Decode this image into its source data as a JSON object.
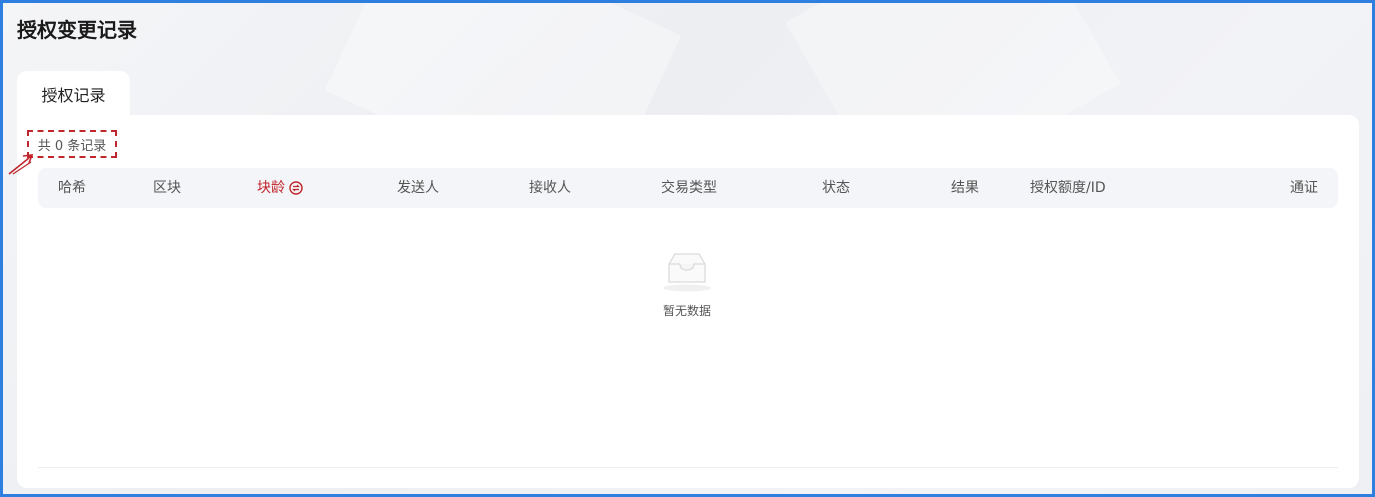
{
  "page": {
    "title": "授权变更记录"
  },
  "tabs": [
    {
      "label": "授权记录",
      "active": true
    }
  ],
  "summary": {
    "total_text": "共 0 条记录"
  },
  "table": {
    "columns": [
      "哈希",
      "区块",
      "块龄",
      "发送人",
      "接收人",
      "交易类型",
      "状态",
      "结果",
      "授权额度/ID",
      "通证"
    ],
    "rows": []
  },
  "empty_state": {
    "text": "暂无数据"
  },
  "colors": {
    "frame_border": "#2f7fe0",
    "accent_red": "#c0262c",
    "header_bg": "#f4f5f8"
  },
  "icons": {
    "age_toggle": "switch-icon",
    "empty": "inbox-icon",
    "annotation": "arrow-icon"
  }
}
